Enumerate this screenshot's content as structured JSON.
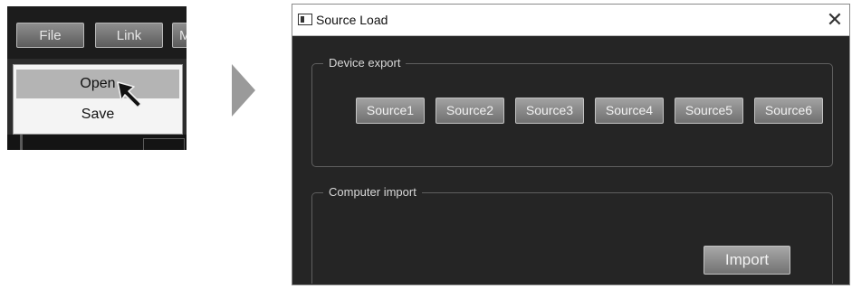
{
  "menu": {
    "bar": {
      "file": "File",
      "link": "Link",
      "more": "M"
    },
    "dropdown": {
      "open": "Open",
      "save": "Save"
    }
  },
  "dialog": {
    "title": "Source Load",
    "close": "✕",
    "device_export": {
      "legend": "Device export",
      "sources": [
        "Source1",
        "Source2",
        "Source3",
        "Source4",
        "Source5",
        "Source6"
      ]
    },
    "computer_import": {
      "legend": "Computer import",
      "import_label": "Import"
    }
  },
  "colors": {
    "panel_bg": "#252525",
    "button_top": "#a2a2a2",
    "button_bottom": "#707070",
    "menu_highlight": "#b4b4b4",
    "arrow": "#9a9a9a"
  }
}
